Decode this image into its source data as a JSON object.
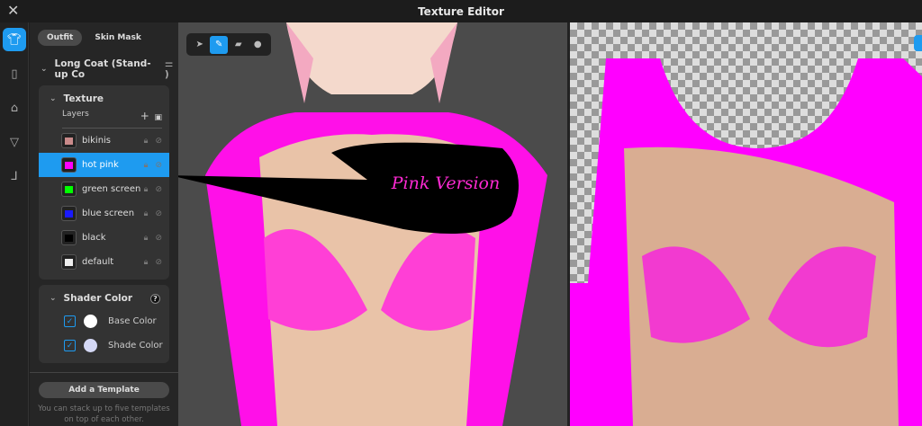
{
  "window": {
    "title": "Texture Editor",
    "close_icon": "close-icon"
  },
  "rail": [
    "shirt-icon",
    "pants-icon",
    "top-icon",
    "underwear-icon",
    "shoes-icon"
  ],
  "sidebar": {
    "tabs": [
      {
        "label": "Outfit",
        "active": true
      },
      {
        "label": "Skin Mask",
        "active": false
      }
    ],
    "item_title": "Long Coat (Stand-up Co",
    "texture": {
      "title": "Texture",
      "layers_label": "Layers",
      "layers": [
        {
          "name": "bikinis",
          "color": "#c98a8a",
          "selected": false
        },
        {
          "name": "hot pink",
          "color": "#ff00ff",
          "selected": true
        },
        {
          "name": "green screen",
          "color": "#00ff00",
          "selected": false
        },
        {
          "name": "blue screen",
          "color": "#1a1aff",
          "selected": false
        },
        {
          "name": "black",
          "color": "#000000",
          "selected": false
        },
        {
          "name": "default",
          "color": "#eeeeee",
          "selected": false
        }
      ]
    },
    "shader": {
      "title": "Shader Color",
      "help": "?",
      "items": [
        {
          "label": "Base Color",
          "color": "#ffffff",
          "checked": true
        },
        {
          "label": "Shade Color",
          "color": "#d4d8f5",
          "checked": true
        }
      ]
    },
    "add_template": "Add a Template",
    "hint": "You can stack up to five templates on top of each other."
  },
  "toolbar": {
    "tools": [
      "select",
      "brush",
      "eraser",
      "fill"
    ],
    "active": "brush"
  },
  "annotation": {
    "text": "Pink Version"
  }
}
